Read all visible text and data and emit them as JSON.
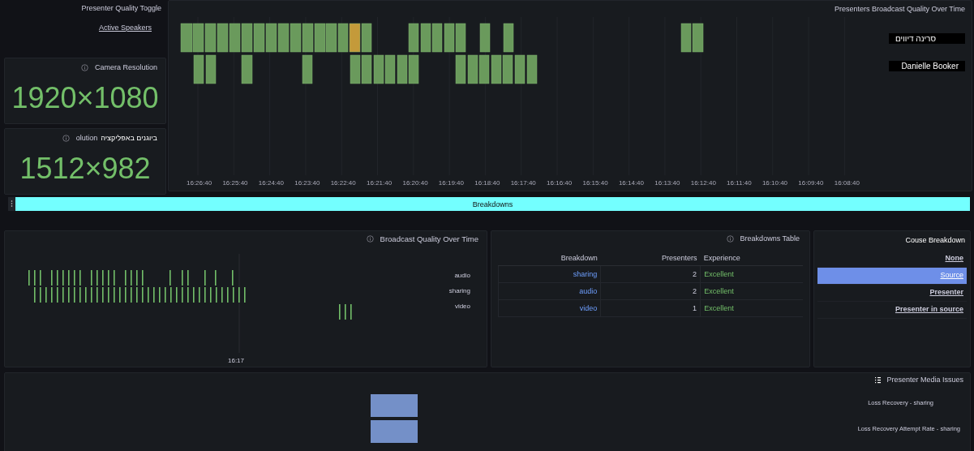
{
  "toggle_panel": {
    "title": "Presenter Quality Toggle",
    "link": "Active Speakers"
  },
  "stats": [
    {
      "title": "Camera Resolution",
      "value": "1920×1080"
    },
    {
      "overlay": "ביוגנים באפליקציה",
      "title": "olution",
      "value": "1512×982"
    }
  ],
  "timeline_panel": {
    "title": "Presenters Broadcast Quality Over Time",
    "legend": [
      "סרינה דיווים",
      "Danielle Booker"
    ],
    "time_labels": [
      "16:26:40",
      "16:25:40",
      "16:24:40",
      "16:23:40",
      "16:22:40",
      "16:21:40",
      "16:20:40",
      "16:19:40",
      "16:18:40",
      "16:17:40",
      "16:16:40",
      "16:15:40",
      "16:14:40",
      "16:13:40",
      "16:12:40",
      "16:11:40",
      "16:10:40",
      "16:09:40",
      "16:08:40"
    ]
  },
  "row_bar": {
    "title": "Breakdowns"
  },
  "broadcast_panel": {
    "title": "Broadcast Quality Over Time",
    "series": [
      "audio",
      "sharing",
      "video"
    ],
    "x_label": "16:17"
  },
  "table": {
    "title": "Breakdowns Table",
    "columns": [
      "Breakdown",
      "Presenters",
      "Experience"
    ],
    "rows": [
      {
        "breakdown": "sharing",
        "presenters": "2",
        "experience": "Excellent"
      },
      {
        "breakdown": "audio",
        "presenters": "2",
        "experience": "Excellent"
      },
      {
        "breakdown": "video",
        "presenters": "1",
        "experience": "Excellent"
      }
    ]
  },
  "cause": {
    "title": "Couse Breakdown",
    "items": [
      {
        "label": "None",
        "selected": false
      },
      {
        "label": "Source",
        "selected": true
      },
      {
        "label": "Presenter",
        "selected": false
      },
      {
        "label": "Presenter in source",
        "selected": false
      }
    ]
  },
  "media": {
    "title": "Presenter Media Issues",
    "rows": [
      "Loss Recovery - sharing",
      "Loss Recovery Attempt Rate - sharing"
    ]
  }
}
